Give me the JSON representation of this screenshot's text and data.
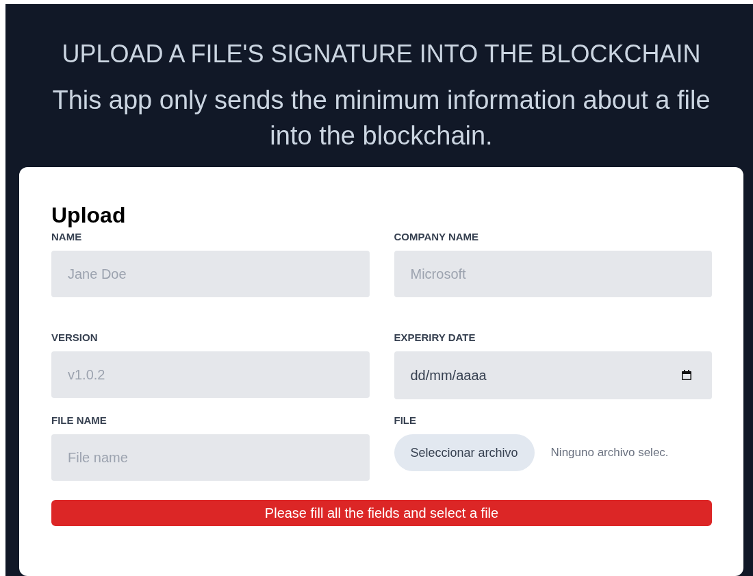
{
  "header": {
    "title": "UPLOAD A FILE'S SIGNATURE INTO THE BLOCKCHAIN",
    "subtitle": "This app only sends the minimum information about a file into the blockchain."
  },
  "form": {
    "title": "Upload",
    "fields": [
      {
        "kind": "text",
        "label": "NAME",
        "placeholder": "Jane Doe"
      },
      {
        "kind": "text",
        "label": "COMPANY NAME",
        "placeholder": "Microsoft"
      },
      {
        "kind": "text",
        "label": "VERSION",
        "placeholder": "v1.0.2"
      },
      {
        "kind": "date",
        "label": "EXPERIRY DATE",
        "placeholder": "dd/mm/aaaa"
      },
      {
        "kind": "text",
        "label": "FILE NAME",
        "placeholder": "File name"
      },
      {
        "kind": "file",
        "label": "FILE",
        "button": "Seleccionar archivo",
        "status": "Ninguno archivo selec."
      }
    ],
    "error": "Please fill all the fields and select a file"
  }
}
